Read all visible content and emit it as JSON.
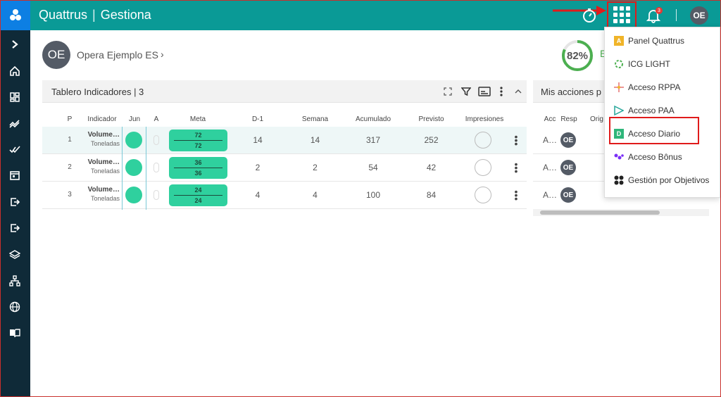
{
  "app": {
    "title": "Quattrus",
    "section": "Gestiona"
  },
  "topbar": {
    "notifications_count": "3",
    "user_initials": "OE"
  },
  "user": {
    "initials": "OE",
    "name": "Opera Ejemplo ES"
  },
  "progress": {
    "percent_label": "82%",
    "value": 0.82,
    "color": "#4caf50",
    "trailing_text": "E"
  },
  "tablero": {
    "title": "Tablero Indicadores | 3",
    "columns": [
      "P",
      "Indicador",
      "Jun",
      "A",
      "Meta",
      "D-1",
      "Semana",
      "Acumulado",
      "Previsto",
      "Impresiones"
    ],
    "rows": [
      {
        "p": "1",
        "indicador": "Volume…",
        "unit": "Toneladas",
        "meta_top": "72",
        "meta_bottom": "72",
        "d1": "14",
        "semana": "14",
        "acumulado": "317",
        "previsto": "252"
      },
      {
        "p": "2",
        "indicador": "Volume…",
        "unit": "Toneladas",
        "meta_top": "36",
        "meta_bottom": "36",
        "d1": "2",
        "semana": "2",
        "acumulado": "54",
        "previsto": "42"
      },
      {
        "p": "3",
        "indicador": "Volume…",
        "unit": "Toneladas",
        "meta_top": "24",
        "meta_bottom": "24",
        "d1": "4",
        "semana": "4",
        "acumulado": "100",
        "previsto": "84"
      }
    ]
  },
  "acciones": {
    "title": "Mis acciones p",
    "columns": [
      "Acc",
      "Resp",
      "Orig"
    ],
    "rows": [
      {
        "acc": "A…",
        "resp": "OE"
      },
      {
        "acc": "A…",
        "resp": "OE"
      },
      {
        "acc": "A…",
        "resp": "OE"
      }
    ]
  },
  "apps_menu": {
    "items": [
      {
        "label": "Panel Quattrus",
        "icon": "panel-quattrus-icon",
        "glyph": "A",
        "color": "#f0b429"
      },
      {
        "label": "ICG LIGHT",
        "icon": "icg-light-icon",
        "glyph": "",
        "color": "#4caf50"
      },
      {
        "label": "Acceso RPPA",
        "icon": "rppa-icon",
        "glyph": "",
        "color": "#e57373"
      },
      {
        "label": "Acceso PAA",
        "icon": "paa-icon",
        "glyph": "",
        "color": "#26a69a"
      },
      {
        "label": "Acceso Diario",
        "icon": "diario-icon",
        "glyph": "D",
        "color": "#2fb67a"
      },
      {
        "label": "Acceso Bônus",
        "icon": "bonus-icon",
        "glyph": "",
        "color": "#7b2ff7"
      },
      {
        "label": "Gestión por Objetivos",
        "icon": "objetivos-icon",
        "glyph": "",
        "color": "#222222"
      }
    ]
  },
  "colors": {
    "topbar": "#0a9a96",
    "sidebar": "#0f2a38",
    "logo": "#0d7fe3",
    "accent_green": "#2fd09e",
    "highlight_red": "#e01b1b"
  }
}
